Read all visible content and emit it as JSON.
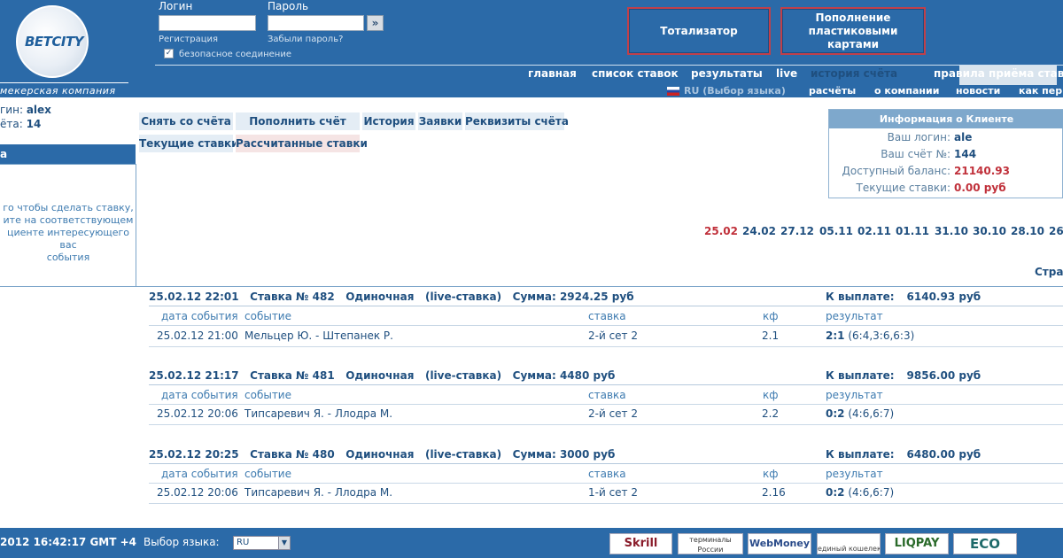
{
  "brand": {
    "logo_text": "BETCITY",
    "tagline": "мекерская компания"
  },
  "login": {
    "login_label": "Логин",
    "password_label": "Пароль",
    "register_link": "Регистрация",
    "forgot_link": "Забыли пароль?",
    "secure_label": "безопасное соединение",
    "submit_glyph": "»"
  },
  "promo_buttons": [
    {
      "label": "Тотализатор"
    },
    {
      "label": "Пополнение пластиковыми картами"
    }
  ],
  "nav": {
    "items": [
      "главная",
      "список ставок",
      "результаты",
      "live",
      "история счёта",
      "правила приёма ставок"
    ],
    "active": "история счёта"
  },
  "subnav": {
    "language": "RU (Выбор языка)",
    "items": [
      "расчёты",
      "о компании",
      "новости",
      "как пер"
    ]
  },
  "left": {
    "user_login_label": "гин:",
    "user_login_value": "alex",
    "user_account_label": "ёта:",
    "user_account_value": "14",
    "header": "а",
    "message": [
      "го чтобы сделать ставку,",
      "ите на соответствующем",
      "циенте интересующего вас",
      "события"
    ]
  },
  "tabs": {
    "row1": [
      "Снять со счёта",
      "Пополнить счёт",
      "История",
      "Заявки",
      "Реквизиты счёта"
    ],
    "row2": [
      "Текущие ставки",
      "Рассчитанные ставки"
    ]
  },
  "client_info": {
    "title": "Информация о Клиенте",
    "rows": [
      {
        "label": "Ваш логин:",
        "value": "ale"
      },
      {
        "label": "Ваш счёт №:",
        "value": "144"
      },
      {
        "label": "Доступный баланс:",
        "value": "21140.93"
      },
      {
        "label": "Текущие ставки:",
        "value": "0.00 руб"
      }
    ]
  },
  "dates": [
    "25.02",
    "24.02",
    "27.12",
    "05.11",
    "02.11",
    "01.11",
    "31.10",
    "30.10",
    "28.10",
    "26"
  ],
  "pages_label": "Стра",
  "columns": [
    "дата события",
    "событие",
    "ставка",
    "кф",
    "результат"
  ],
  "bets": [
    {
      "datetime": "25.02.12 22:01",
      "number": "Ставка № 482",
      "type": "Одиночная",
      "mode": "(live-ставка)",
      "sum": "Сумма: 2924.25 руб",
      "payout_label": "К выплате:",
      "payout": "6140.93 руб",
      "event_date": "25.02.12 21:00",
      "event": "Мельцер Ю. - Штепанек Р.",
      "stake": "2-й сет 2",
      "odds": "2.1",
      "result_score": "2:1",
      "result_detail": "(6:4,3:6,6:3)"
    },
    {
      "datetime": "25.02.12 21:17",
      "number": "Ставка № 481",
      "type": "Одиночная",
      "mode": "(live-ставка)",
      "sum": "Сумма: 4480 руб",
      "payout_label": "К выплате:",
      "payout": "9856.00 руб",
      "event_date": "25.02.12 20:06",
      "event": "Типсаревич Я. - Ллодра М.",
      "stake": "2-й сет 2",
      "odds": "2.2",
      "result_score": "0:2",
      "result_detail": "(4:6,6:7)"
    },
    {
      "datetime": "25.02.12 20:25",
      "number": "Ставка № 480",
      "type": "Одиночная",
      "mode": "(live-ставка)",
      "sum": "Сумма: 3000 руб",
      "payout_label": "К выплате:",
      "payout": "6480.00 руб",
      "event_date": "25.02.12 20:06",
      "event": "Типсаревич Я. - Ллодра М.",
      "stake": "1-й сет 2",
      "odds": "2.16",
      "result_score": "0:2",
      "result_detail": "(4:6,6:7)"
    }
  ],
  "footer": {
    "clock": "2012  16:42:17  GMT +4",
    "language_label": "Выбор языка:",
    "language_value": "RU",
    "payments": [
      "Skrill",
      "терминалы России",
      "WebMoney",
      "единый кошелек",
      "LIQPAY",
      "ECO"
    ]
  }
}
